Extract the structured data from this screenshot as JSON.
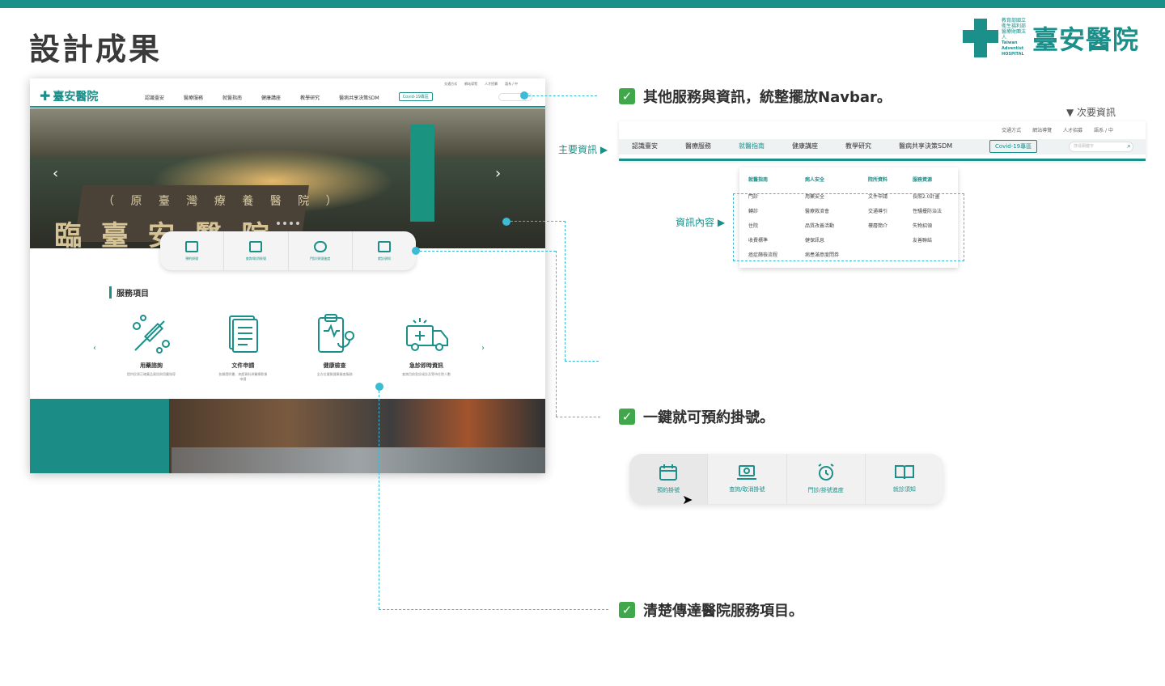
{
  "page_title": "設計成果",
  "logo": {
    "small_line1": "教育部國立",
    "small_line2": "衛生福利部",
    "small_line3": "醫療財團法人",
    "small_en1": "Taiwan Adventist",
    "small_en2": "HOSPITAL",
    "big": "臺安醫院"
  },
  "mockup": {
    "logo": "臺安醫院",
    "util": [
      "交通方式",
      "網站導覽",
      "人才招募",
      "語系 / 中"
    ],
    "nav": [
      "認識臺安",
      "醫療服務",
      "就醫指南",
      "健康講座",
      "教學研究",
      "醫病共享決策SDM"
    ],
    "covid": "Covid-19專區",
    "hero_sign": "（ 原 臺 灣 療 養 醫 院 ）",
    "hero_big": "臨 臺 安 醫 院",
    "quick": [
      "預約掛號",
      "查詢/取消掛號",
      "門診/掛號進度",
      "就診須知"
    ],
    "services_title": "服務項目",
    "services": [
      {
        "name": "用藥諮詢",
        "desc": "提供民眾正確藥品資訊與用藥指導"
      },
      {
        "name": "文件申請",
        "desc": "各類證明書、病歷資料與醫療影像申請"
      },
      {
        "name": "健康檢查",
        "desc": "全方位優質健康檢查服務"
      },
      {
        "name": "急診即時資訊",
        "desc": "查詢目前急診候診及等待住院人數"
      }
    ]
  },
  "annotations": {
    "a1": "其他服務與資訊，統整擺放Navbar。",
    "a2": "一鍵就可預約掛號。",
    "a3": "清楚傳達醫院服務項目。"
  },
  "navbar_detail": {
    "label_secondary": "▼ 次要資訊",
    "label_main": "主要資訊 ▶",
    "label_content": "資訊內容 ▶",
    "util": [
      "交通方式",
      "網站導覽",
      "人才招募",
      "語系 / 中"
    ],
    "items": [
      "認識臺安",
      "醫療服務",
      "就醫指南",
      "健康講座",
      "教學研究",
      "醫病共享決策SDM"
    ],
    "covid": "Covid-19專區",
    "search_placeholder": "搜尋關鍵字",
    "dropdown": [
      {
        "header": "就醫指南",
        "items": [
          "門診",
          "轉診",
          "住院",
          "收費標準",
          "癌症篩檢流程"
        ]
      },
      {
        "header": "病人安全",
        "items": [
          "用藥安全",
          "醫療救濟會",
          "品質改善活動",
          "健保訊息",
          "病患滿意度問券"
        ]
      },
      {
        "header": "院所資料",
        "items": [
          "文件申請",
          "交通導引",
          "樓層簡介"
        ]
      },
      {
        "header": "服務資源",
        "items": [
          "長照2.0計畫",
          "性騷擾防治法",
          "失物招領",
          "友善聯結"
        ]
      }
    ]
  },
  "quick_detail": [
    "預約掛號",
    "查詢/取消掛號",
    "門診/掛號進度",
    "就診須知"
  ],
  "colors": {
    "brand": "#1b8f8a",
    "connector": "#3bbbd6",
    "check": "#3ea84a"
  }
}
